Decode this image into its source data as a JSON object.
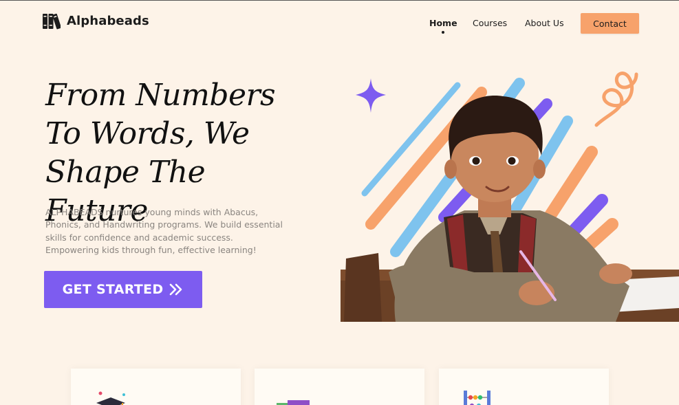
{
  "brand": {
    "name": "Alphabeads",
    "logo_icon": "books-icon"
  },
  "nav": {
    "links": [
      {
        "label": "Home",
        "active": true
      },
      {
        "label": "Courses",
        "active": false
      },
      {
        "label": "About Us",
        "active": false
      }
    ],
    "contact_label": "Contact"
  },
  "hero": {
    "title": "From Numbers To Words, We Shape The Future",
    "description": "ALPHABEADS nurtures young minds with Abacus, Phonics, and Handwriting programs. We build essential skills for confidence and academic success. Empowering kids through fun, effective learning!",
    "cta_label": "GET STARTED",
    "cta_icon": "double-chevron-right-icon",
    "image": "child-writing-at-desk-illustration"
  },
  "cards": [
    {
      "icon": "graduation-cap-icon"
    },
    {
      "icon": "books-stack-icon"
    },
    {
      "icon": "abacus-icon"
    }
  ],
  "colors": {
    "background": "#fdf3e8",
    "accent_purple": "#7d5cf0",
    "accent_orange": "#f7a26b",
    "stroke_blue": "#7ec3ee"
  }
}
